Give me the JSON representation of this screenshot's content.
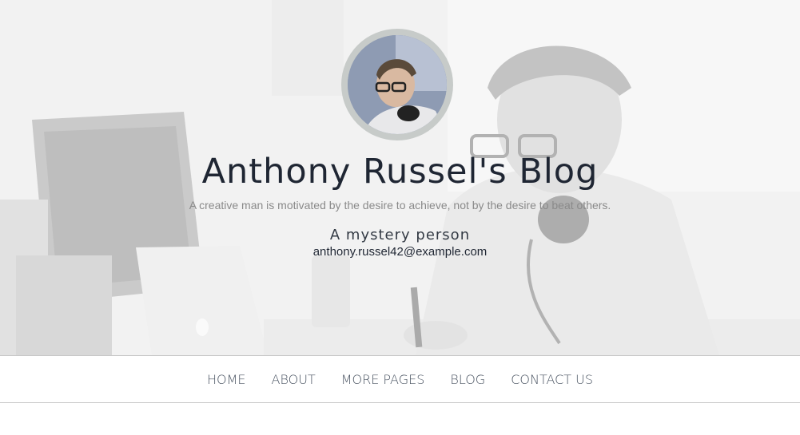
{
  "header": {
    "title": "Anthony Russel's Blog",
    "tagline": "A creative man is motivated by the desire to achieve, not by the desire to beat others.",
    "author_role": "A mystery person",
    "author_email": "anthony.russel42@example.com",
    "avatar_icon": "person-portrait-icon"
  },
  "nav": {
    "items": [
      {
        "label": "HOME"
      },
      {
        "label": "ABOUT"
      },
      {
        "label": "MORE PAGES"
      },
      {
        "label": "BLOG"
      },
      {
        "label": "CONTACT US"
      }
    ]
  },
  "colors": {
    "title": "#1f2633",
    "tagline": "#8a8a8a",
    "nav_text": "#4b5563",
    "avatar_ring": "#c7cbc9"
  }
}
